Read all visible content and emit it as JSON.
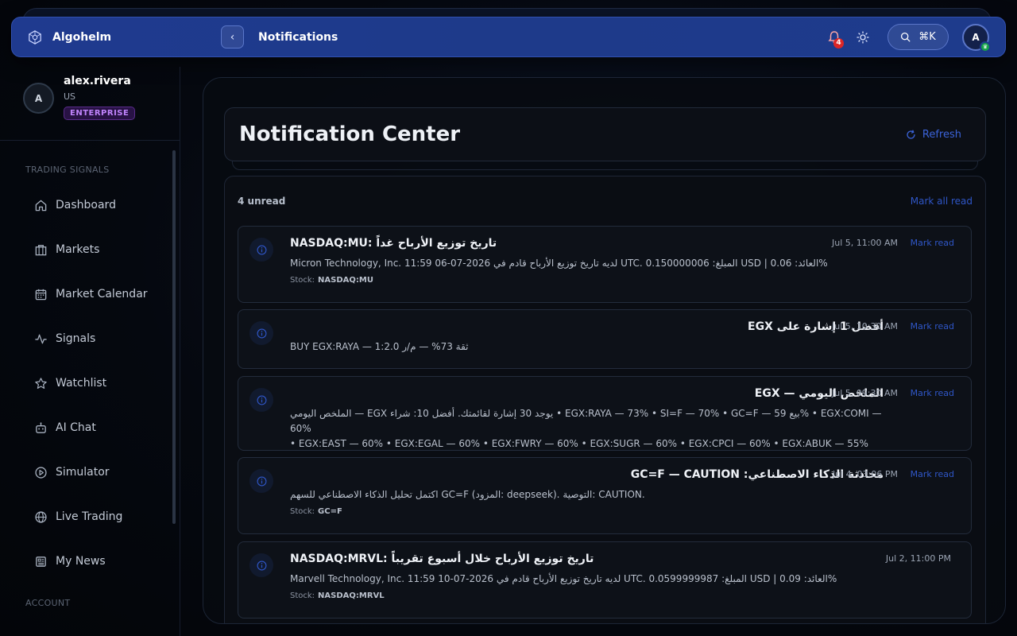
{
  "app": {
    "name": "Algohelm",
    "page_title": "Notifications"
  },
  "topbar": {
    "notification_count": "4",
    "search_shortcut": "⌘K",
    "avatar_initial": "A"
  },
  "profile": {
    "initial": "A",
    "username": "alex.rivera",
    "country": "US",
    "plan": "ENTERPRISE"
  },
  "sidebar": {
    "section_label": "TRADING SIGNALS",
    "section_label_2": "ACCOUNT",
    "items": [
      {
        "label": "Dashboard",
        "icon": "home-icon"
      },
      {
        "label": "Markets",
        "icon": "building-icon"
      },
      {
        "label": "Market Calendar",
        "icon": "calendar-icon"
      },
      {
        "label": "Signals",
        "icon": "activity-icon"
      },
      {
        "label": "Watchlist",
        "icon": "star-icon"
      },
      {
        "label": "AI Chat",
        "icon": "bot-icon"
      },
      {
        "label": "Simulator",
        "icon": "play-circle-icon"
      },
      {
        "label": "Live Trading",
        "icon": "globe-icon"
      },
      {
        "label": "My News",
        "icon": "newspaper-icon"
      }
    ]
  },
  "main": {
    "title": "Notification Center",
    "refresh_label": "Refresh",
    "unread_label": "4 unread",
    "mark_all_label": "Mark all read",
    "mark_read_label": "Mark read",
    "meta_stock_label": "Stock:",
    "notifications": [
      {
        "title": "NASDAQ:MU: تاريخ توزيع الأرباح غداً",
        "text": "Micron Technology, Inc. لديه تاريخ توزيع الأرباح قادم في 2026-07-06 11:59 UTC. المبلغ: 0.150000006 USD | العائد: 0.06%",
        "stock": "NASDAQ:MU",
        "time": "Jul 5, 11:00 AM"
      },
      {
        "title": "أفضل 1 إشارة على EGX",
        "text": "BUY EGX:RAYA — ثقة 73% — م/ر 1:2.0",
        "time": "Jul 5, 10:30 AM"
      },
      {
        "title": "الملخص اليومي — EGX",
        "text": "الملخص اليومي — EGX يوجد 30 إشارة لقائمتك. أفضل 10: شراء • EGX:RAYA — 73% • SI=F — 70% • GC=F — بيع 59% • EGX:COMI — 60%",
        "text2": "• EGX:EAST — 60% • EGX:EGAL — 60% • EGX:FWRY — 60% • EGX:SUGR — 60% • EGX:CPCI — 60% • EGX:ABUK — 55%",
        "time": "Jul 5, 09:30 AM"
      },
      {
        "title": "محادثة الذكاء الاصطناعي: GC=F — CAUTION",
        "text": "اكتمل تحليل الذكاء الاصطناعي للسهم GC=F (المزود: deepseek). التوصية: CAUTION.",
        "stock": "GC=F",
        "time": "Jul 4, 03:06 PM"
      },
      {
        "title": "NASDAQ:MRVL: تاريخ توزيع الأرباح خلال أسبوع تقريباً",
        "text": "Marvell Technology, Inc. لديه تاريخ توزيع الأرباح قادم في 2026-07-10 11:59 UTC. المبلغ: 0.0599999987 USD | العائد: 0.09%",
        "stock": "NASDAQ:MRVL",
        "time": "Jul 2, 11:00 PM"
      }
    ]
  },
  "colors": {
    "accent": "#1e3a8a",
    "link": "#2f56c7",
    "badge": "#dc2626"
  }
}
